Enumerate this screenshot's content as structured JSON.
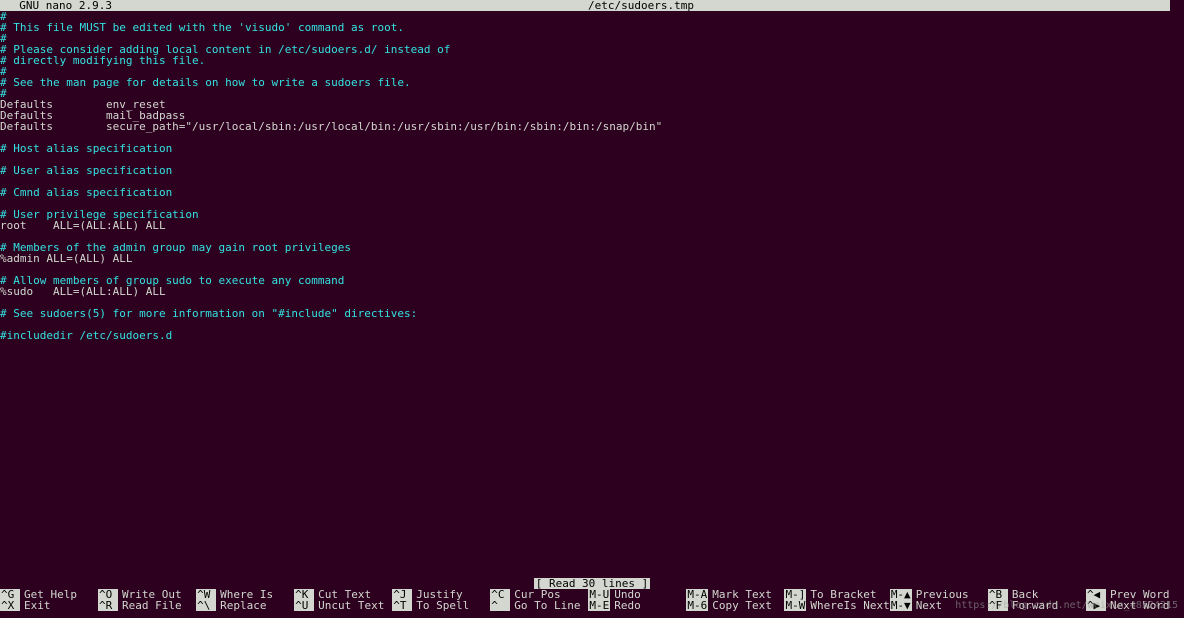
{
  "title_left": "  GNU nano 2.9.3",
  "title_center": "/etc/sudoers.tmp",
  "lines": [
    {
      "cls": "c-comment",
      "text": "#"
    },
    {
      "cls": "c-comment",
      "text": "# This file MUST be edited with the 'visudo' command as root."
    },
    {
      "cls": "c-comment",
      "text": "#"
    },
    {
      "cls": "c-comment",
      "text": "# Please consider adding local content in /etc/sudoers.d/ instead of"
    },
    {
      "cls": "c-comment",
      "text": "# directly modifying this file."
    },
    {
      "cls": "c-comment",
      "text": "#"
    },
    {
      "cls": "c-comment",
      "text": "# See the man page for details on how to write a sudoers file."
    },
    {
      "cls": "c-comment",
      "text": "#"
    },
    {
      "cls": "c-text",
      "text": "Defaults        env_reset"
    },
    {
      "cls": "c-text",
      "text": "Defaults        mail_badpass"
    },
    {
      "cls": "c-text",
      "text": "Defaults        secure_path=\"/usr/local/sbin:/usr/local/bin:/usr/sbin:/usr/bin:/sbin:/bin:/snap/bin\""
    },
    {
      "cls": "c-text",
      "text": " "
    },
    {
      "cls": "c-comment",
      "text": "# Host alias specification"
    },
    {
      "cls": "c-text",
      "text": " "
    },
    {
      "cls": "c-comment",
      "text": "# User alias specification"
    },
    {
      "cls": "c-text",
      "text": " "
    },
    {
      "cls": "c-comment",
      "text": "# Cmnd alias specification"
    },
    {
      "cls": "c-text",
      "text": " "
    },
    {
      "cls": "c-comment",
      "text": "# User privilege specification"
    },
    {
      "cls": "c-text",
      "text": "root    ALL=(ALL:ALL) ALL"
    },
    {
      "cls": "c-text",
      "text": " "
    },
    {
      "cls": "c-comment",
      "text": "# Members of the admin group may gain root privileges"
    },
    {
      "cls": "c-text",
      "text": "%admin ALL=(ALL) ALL"
    },
    {
      "cls": "c-text",
      "text": " "
    },
    {
      "cls": "c-comment",
      "text": "# Allow members of group sudo to execute any command"
    },
    {
      "cls": "c-text",
      "text": "%sudo   ALL=(ALL:ALL) ALL"
    },
    {
      "cls": "c-text",
      "text": " "
    },
    {
      "cls": "c-comment",
      "text": "# See sudoers(5) for more information on \"#include\" directives:"
    },
    {
      "cls": "c-text",
      "text": " "
    },
    {
      "cls": "c-comment",
      "text": "#includedir /etc/sudoers.d"
    }
  ],
  "status": "[ Read 30 lines ]",
  "shortcuts": [
    {
      "key": "^G",
      "label": "Get Help"
    },
    {
      "key": "^X",
      "label": "Exit"
    },
    {
      "key": "^O",
      "label": "Write Out"
    },
    {
      "key": "^R",
      "label": "Read File"
    },
    {
      "key": "^W",
      "label": "Where Is"
    },
    {
      "key": "^\\",
      "label": "Replace"
    },
    {
      "key": "^K",
      "label": "Cut Text"
    },
    {
      "key": "^U",
      "label": "Uncut Text"
    },
    {
      "key": "^J",
      "label": "Justify"
    },
    {
      "key": "^T",
      "label": "To Spell"
    },
    {
      "key": "^C",
      "label": "Cur Pos"
    },
    {
      "key": "^_",
      "label": "Go To Line"
    },
    {
      "key": "M-U",
      "label": "Undo"
    },
    {
      "key": "M-E",
      "label": "Redo"
    },
    {
      "key": "M-A",
      "label": "Mark Text"
    },
    {
      "key": "M-6",
      "label": "Copy Text"
    },
    {
      "key": "M-]",
      "label": "To Bracket"
    },
    {
      "key": "M-W",
      "label": "WhereIs Next"
    },
    {
      "key": "M-▲",
      "label": "Previous"
    },
    {
      "key": "M-▼",
      "label": "Next"
    },
    {
      "key": "^B",
      "label": "Back"
    },
    {
      "key": "^F",
      "label": "Forward"
    },
    {
      "key": "^◀",
      "label": "Prev Word"
    },
    {
      "key": "^▶",
      "label": "Next Word"
    }
  ],
  "watermark": "https://blog.csdn.net/weixin_48524215"
}
